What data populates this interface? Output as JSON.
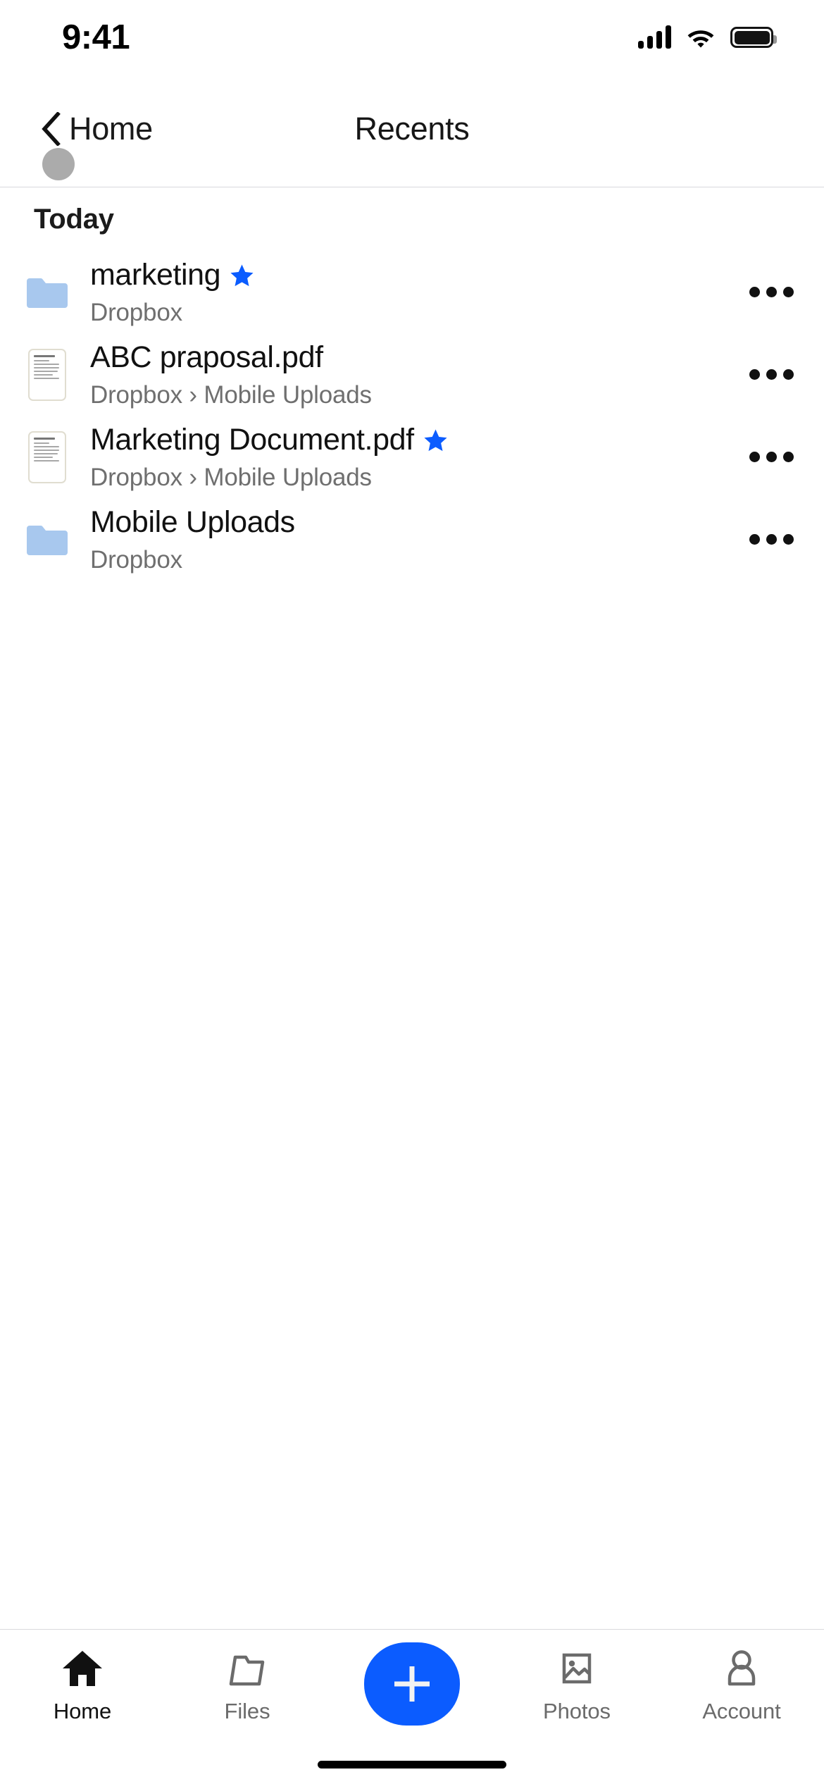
{
  "status_bar": {
    "time": "9:41",
    "icons": [
      "cellular-signal-icon",
      "wifi-icon",
      "battery-icon"
    ]
  },
  "nav_bar": {
    "back_label": "Home",
    "back_icon": "chevron-left-icon",
    "title": "Recents",
    "tap_indicator": "tap-highlight-circle"
  },
  "content": {
    "section_title": "Today",
    "items": [
      {
        "name": "marketing",
        "subtitle": "Dropbox",
        "icon": "folder-icon",
        "starred": true,
        "star_icon": "star-icon",
        "more_icon": "more-horizontal-icon"
      },
      {
        "name": "ABC praposal.pdf",
        "subtitle": "Dropbox › Mobile Uploads",
        "icon": "pdf-document-thumbnail-icon",
        "starred": false,
        "star_icon": "",
        "more_icon": "more-horizontal-icon"
      },
      {
        "name": "Marketing Document.pdf",
        "subtitle": "Dropbox › Mobile Uploads",
        "icon": "pdf-document-thumbnail-icon",
        "starred": true,
        "star_icon": "star-icon",
        "more_icon": "more-horizontal-icon"
      },
      {
        "name": "Mobile Uploads",
        "subtitle": "Dropbox",
        "icon": "folder-icon",
        "starred": false,
        "star_icon": "",
        "more_icon": "more-horizontal-icon"
      }
    ]
  },
  "tab_bar": {
    "tabs": [
      {
        "label": "Home",
        "icon": "home-icon",
        "active": true
      },
      {
        "label": "Files",
        "icon": "folder-outline-icon",
        "active": false
      },
      {
        "label": "Photos",
        "icon": "photo-icon",
        "active": false
      },
      {
        "label": "Account",
        "icon": "person-icon",
        "active": false
      }
    ],
    "create_button": {
      "icon": "plus-icon",
      "label": ""
    }
  },
  "colors": {
    "accent_blue": "#0B5CFF",
    "star_blue": "#0B5CFF",
    "folder_blue": "#A8C8EE",
    "primary_text": "#111111",
    "secondary_text": "#6F6F6F",
    "separator": "#D9D9DD",
    "pdf_border": "#E0DDD0"
  }
}
